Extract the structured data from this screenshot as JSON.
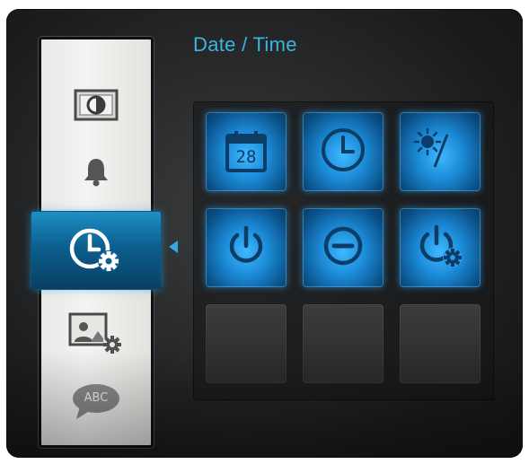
{
  "page": {
    "title": "Date / Time"
  },
  "sidebar": {
    "items": [
      {
        "id": "brightness",
        "icon": "brightness-contrast-icon"
      },
      {
        "id": "alarm",
        "icon": "bell-icon"
      },
      {
        "id": "datetime",
        "icon": "clock-gear-icon",
        "selected": true
      },
      {
        "id": "picture-settings",
        "icon": "picture-gear-icon"
      },
      {
        "id": "language",
        "icon": "abc-speech-bubble-icon",
        "label": "ABC"
      }
    ]
  },
  "grid": {
    "tiles": [
      {
        "icon": "calendar-icon",
        "text": "28",
        "state": "active"
      },
      {
        "icon": "clock-icon",
        "state": "active"
      },
      {
        "icon": "day-night-icon",
        "state": "active"
      },
      {
        "icon": "power-on-icon",
        "state": "active"
      },
      {
        "icon": "power-off-icon",
        "state": "active"
      },
      {
        "icon": "power-gear-icon",
        "state": "active"
      },
      {
        "icon": "",
        "state": "empty"
      },
      {
        "icon": "",
        "state": "empty"
      },
      {
        "icon": "",
        "state": "empty"
      }
    ]
  },
  "colors": {
    "accent": "#3ab5e6",
    "tile_glow": "#3fb8ff",
    "sidebar_bg": "#ececea"
  }
}
